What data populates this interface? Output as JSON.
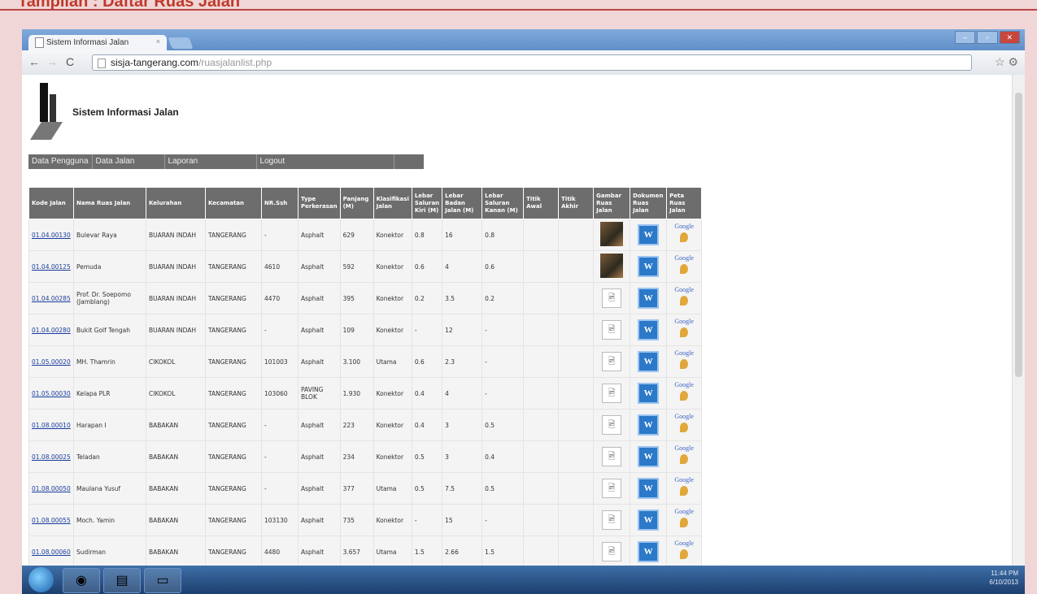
{
  "page_heading": "Tampilan : Daftar Ruas Jalan",
  "browser": {
    "tab_title": "Sistem Informasi Jalan",
    "tab_close": "×",
    "url_host": "sisja-tangerang.com",
    "url_path": "/ruasjalanlist.php"
  },
  "site": {
    "title": "Sistem Informasi Jalan"
  },
  "menu": [
    "Data Pengguna",
    "Data Jalan",
    "Laporan",
    "Logout"
  ],
  "table": {
    "headers": [
      "Kode Jalan",
      "Nama Ruas Jalan",
      "Kelurahan",
      "Kecamatan",
      "NR.Ssh",
      "Type Perkerasan",
      "Panjang (M)",
      "Klasifikasi Jalan",
      "Lebar Saluran Kiri (M)",
      "Lebar Badan Jalan (M)",
      "Lebar Saluran Kanan (M)",
      "Titik Awal",
      "Titik Akhir",
      "Gambar Ruas Jalan",
      "Dokumen Ruas Jalan",
      "Peta Ruas Jalan"
    ],
    "rows": [
      {
        "kode": "01.04.00130",
        "nama": "Bulevar Raya",
        "kel": "BUARAN INDAH",
        "kec": "TANGERANG",
        "nr": "-",
        "type": "Asphalt",
        "panjang": "629",
        "klas": "Konektor",
        "kiri": "0.8",
        "badan": "16",
        "kanan": "0.8",
        "photo": true
      },
      {
        "kode": "01.04.00125",
        "nama": "Pemuda",
        "kel": "BUARAN INDAH",
        "kec": "TANGERANG",
        "nr": "4610",
        "type": "Asphalt",
        "panjang": "592",
        "klas": "Konektor",
        "kiri": "0.6",
        "badan": "4",
        "kanan": "0.6",
        "photo": true
      },
      {
        "kode": "01.04.00285",
        "nama": "Prof. Dr. Soepomo (Jamblang)",
        "kel": "BUARAN INDAH",
        "kec": "TANGERANG",
        "nr": "4470",
        "type": "Asphalt",
        "panjang": "395",
        "klas": "Konektor",
        "kiri": "0.2",
        "badan": "3.5",
        "kanan": "0.2",
        "photo": false
      },
      {
        "kode": "01.04.00280",
        "nama": "Bukit Golf Tengah",
        "kel": "BUARAN INDAH",
        "kec": "TANGERANG",
        "nr": "-",
        "type": "Asphalt",
        "panjang": "109",
        "klas": "Konektor",
        "kiri": "-",
        "badan": "12",
        "kanan": "-",
        "photo": false
      },
      {
        "kode": "01.05.00020",
        "nama": "MH. Thamrin",
        "kel": "CIKOKOL",
        "kec": "TANGERANG",
        "nr": "101003",
        "type": "Asphalt",
        "panjang": "3.100",
        "klas": "Utama",
        "kiri": "0.6",
        "badan": "2.3",
        "kanan": "-",
        "photo": false
      },
      {
        "kode": "01.05.00030",
        "nama": "Kelapa PLR",
        "kel": "CIKOKOL",
        "kec": "TANGERANG",
        "nr": "103060",
        "type": "PAVING BLOK",
        "panjang": "1.930",
        "klas": "Konektor",
        "kiri": "0.4",
        "badan": "4",
        "kanan": "-",
        "photo": false
      },
      {
        "kode": "01.08.00010",
        "nama": "Harapan I",
        "kel": "BABAKAN",
        "kec": "TANGERANG",
        "nr": "-",
        "type": "Asphalt",
        "panjang": "223",
        "klas": "Konektor",
        "kiri": "0.4",
        "badan": "3",
        "kanan": "0.5",
        "photo": false
      },
      {
        "kode": "01.08.00025",
        "nama": "Teladan",
        "kel": "BABAKAN",
        "kec": "TANGERANG",
        "nr": "-",
        "type": "Asphalt",
        "panjang": "234",
        "klas": "Konektor",
        "kiri": "0.5",
        "badan": "3",
        "kanan": "0.4",
        "photo": false
      },
      {
        "kode": "01.08.00050",
        "nama": "Maulana Yusuf",
        "kel": "BABAKAN",
        "kec": "TANGERANG",
        "nr": "-",
        "type": "Asphalt",
        "panjang": "377",
        "klas": "Utama",
        "kiri": "0.5",
        "badan": "7.5",
        "kanan": "0.5",
        "photo": false
      },
      {
        "kode": "01.08.00055",
        "nama": "Moch. Yamin",
        "kel": "BABAKAN",
        "kec": "TANGERANG",
        "nr": "103130",
        "type": "Asphalt",
        "panjang": "735",
        "klas": "Konektor",
        "kiri": "-",
        "badan": "15",
        "kanan": "-",
        "photo": false
      },
      {
        "kode": "01.08.00060",
        "nama": "Sudirman",
        "kel": "BABAKAN",
        "kec": "TANGERANG",
        "nr": "4480",
        "type": "Asphalt",
        "panjang": "3.657",
        "klas": "Utama",
        "kiri": "1.5",
        "badan": "2.66",
        "kanan": "1.5",
        "photo": false
      }
    ],
    "doc_icon_letter": "W",
    "map_text": "Google"
  },
  "tray": {
    "time": "11:44 PM",
    "date": "6/10/2013"
  }
}
